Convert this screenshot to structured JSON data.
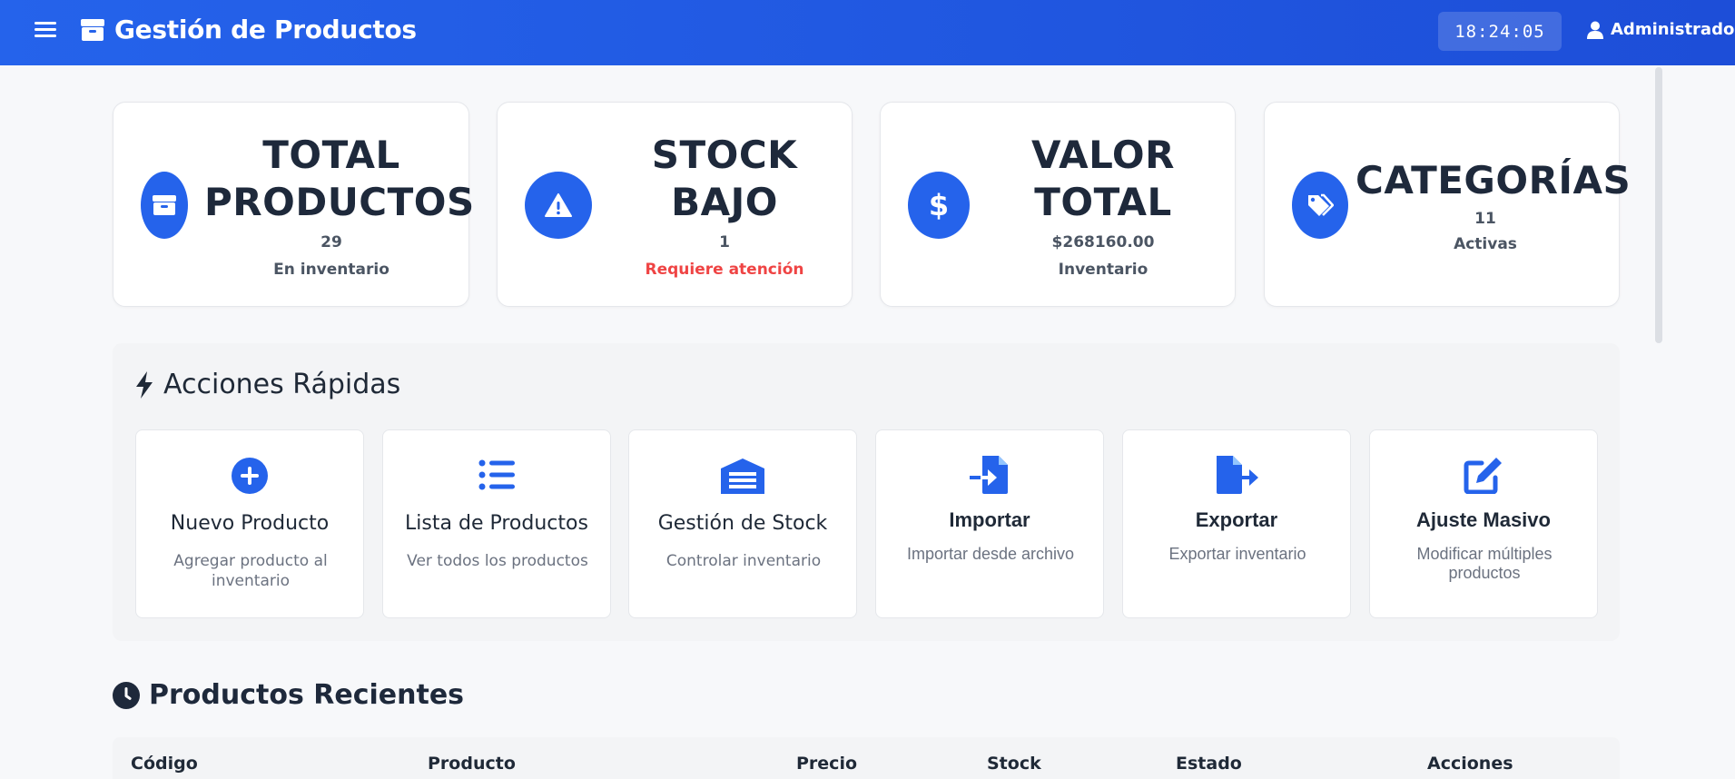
{
  "header": {
    "title": "Gestión de Productos",
    "clock": "18:24:05",
    "user": "Administrador",
    "menu_icon": "hamburger-icon",
    "brand_icon": "box-icon",
    "user_icon": "user-icon",
    "accent": "#2563eb"
  },
  "stats": [
    {
      "title_lines": [
        "TOTAL",
        "PRODUCTOS"
      ],
      "value": "29",
      "sub": "En inventario",
      "icon": "box-icon"
    },
    {
      "title_lines": [
        "STOCK",
        "BAJO"
      ],
      "value": "1",
      "sub": "Requiere atención",
      "sub_color": "#ef4444",
      "icon": "warning-icon"
    },
    {
      "title_lines": [
        "VALOR",
        "TOTAL"
      ],
      "value": "$268160.00",
      "sub": "Inventario",
      "icon": "dollar-icon"
    },
    {
      "title_lines": [
        "CATEGORÍAS"
      ],
      "value": "11",
      "sub": "Activas",
      "icon": "tags-icon"
    }
  ],
  "quick_actions": {
    "heading": "Acciones Rápidas",
    "icon": "bolt-icon",
    "items": [
      {
        "title": "Nuevo Producto",
        "desc": "Agregar producto al inventario",
        "icon": "plus-circle-icon"
      },
      {
        "title": "Lista de Productos",
        "desc": "Ver todos los productos",
        "icon": "list-icon"
      },
      {
        "title": "Gestión de Stock",
        "desc": "Controlar inventario",
        "icon": "warehouse-icon"
      },
      {
        "title": "Importar",
        "desc": "Importar desde archivo",
        "icon": "file-import-icon"
      },
      {
        "title": "Exportar",
        "desc": "Exportar inventario",
        "icon": "file-export-icon"
      },
      {
        "title": "Ajuste Masivo",
        "desc": "Modificar múltiples productos",
        "icon": "edit-icon"
      }
    ]
  },
  "recent": {
    "heading": "Productos Recientes",
    "icon": "clock-icon",
    "columns": [
      "Código",
      "Producto",
      "Precio",
      "Stock",
      "Estado",
      "Acciones"
    ]
  }
}
